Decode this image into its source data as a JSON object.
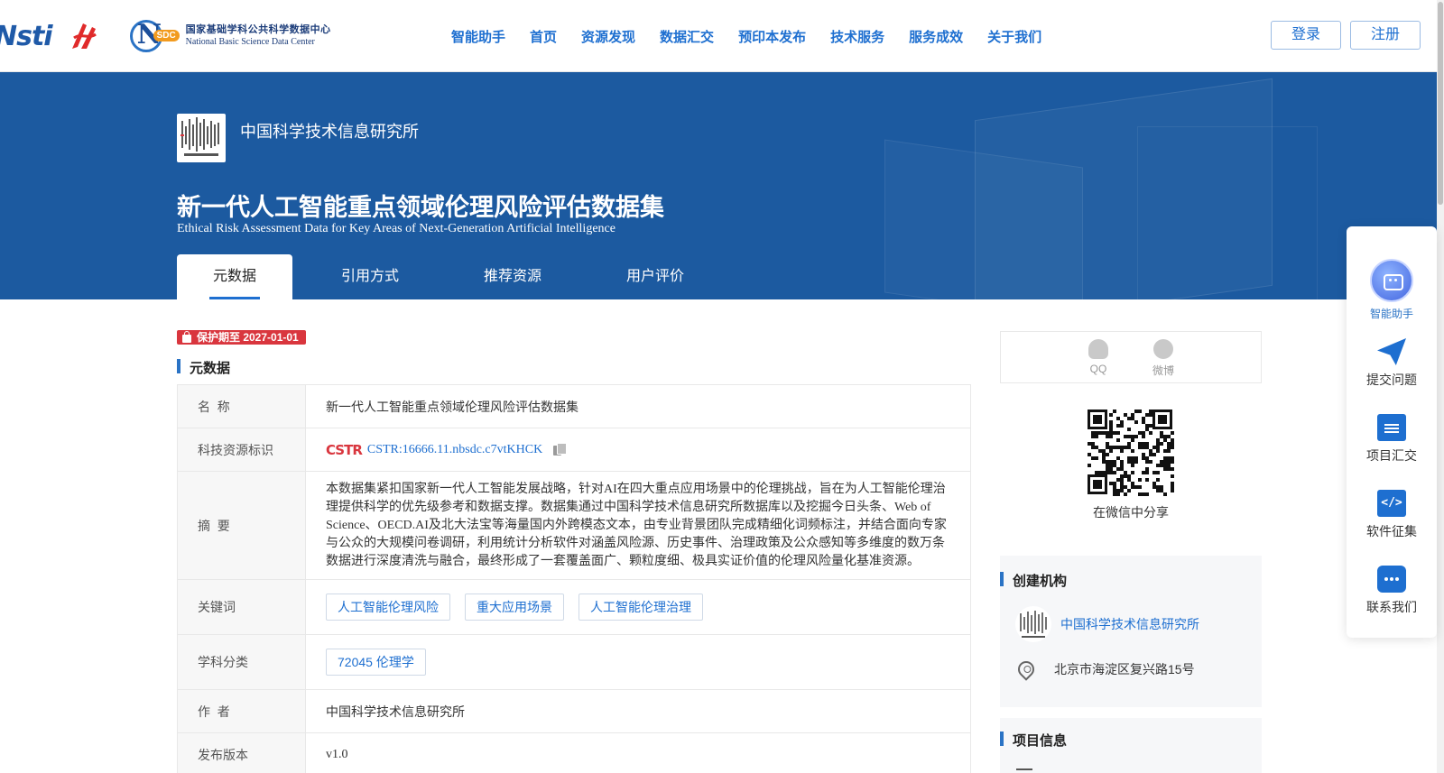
{
  "header": {
    "logo_nsti": "Nsti",
    "nsdc_cn": "国家基础学科公共科学数据中心",
    "nsdc_en": "National Basic Science Data Center",
    "nav": [
      "智能助手",
      "首页",
      "资源发现",
      "数据汇交",
      "预印本发布",
      "技术服务",
      "服务成效",
      "关于我们"
    ],
    "login": "登录",
    "register": "注册"
  },
  "banner": {
    "org_name": "中国科学技术信息研究所",
    "title": "新一代人工智能重点领域伦理风险评估数据集",
    "subtitle": "Ethical Risk Assessment Data for Key Areas of Next-Generation Artificial Intelligence",
    "tabs": [
      "元数据",
      "引用方式",
      "推荐资源",
      "用户评价"
    ]
  },
  "protection": "保护期至 2027-01-01",
  "metadata": {
    "section_title": "元数据",
    "rows": [
      {
        "key": "名  称",
        "value": "新一代人工智能重点领域伦理风险评估数据集"
      },
      {
        "key": "科技资源标识",
        "value": "CSTR:16666.11.nbsdc.c7vtKHCK"
      },
      {
        "key": "摘  要",
        "value": "本数据集紧扣国家新一代人工智能发展战略，针对AI在四大重点应用场景中的伦理挑战，旨在为人工智能伦理治理提供科学的优先级参考和数据支撑。数据集通过中国科学技术信息研究所数据库以及挖掘今日头条、Web of Science、OECD.AI及北大法宝等海量国内外跨模态文本，由专业背景团队完成精细化词频标注，并结合面向专家与公众的大规模问卷调研，利用统计分析软件对涵盖风险源、历史事件、治理政策及公众感知等多维度的数万条数据进行深度清洗与融合，最终形成了一套覆盖面广、颗粒度细、极具实证价值的伦理风险量化基准资源。"
      },
      {
        "key": "关键词",
        "keywords": [
          "人工智能伦理风险",
          "重大应用场景",
          "人工智能伦理治理"
        ]
      },
      {
        "key": "学科分类",
        "keywords": [
          "72045 伦理学"
        ]
      },
      {
        "key": "作  者",
        "value": "中国科学技术信息研究所"
      },
      {
        "key": "发布版本",
        "value": "v1.0"
      }
    ]
  },
  "share": {
    "qq": "QQ",
    "weibo": "微博",
    "qr_caption": "在微信中分享"
  },
  "creator": {
    "section_title": "创建机构",
    "name": "中国科学技术信息研究所",
    "address": "北京市海淀区复兴路15号"
  },
  "project": {
    "section_title": "项目信息"
  },
  "float_bar": [
    "智能助手",
    "提交问题",
    "项目汇交",
    "软件征集",
    "联系我们"
  ],
  "colors": {
    "primary": "#1e6fd0",
    "banner": "#1c5aa0",
    "badge": "#d9363e"
  }
}
